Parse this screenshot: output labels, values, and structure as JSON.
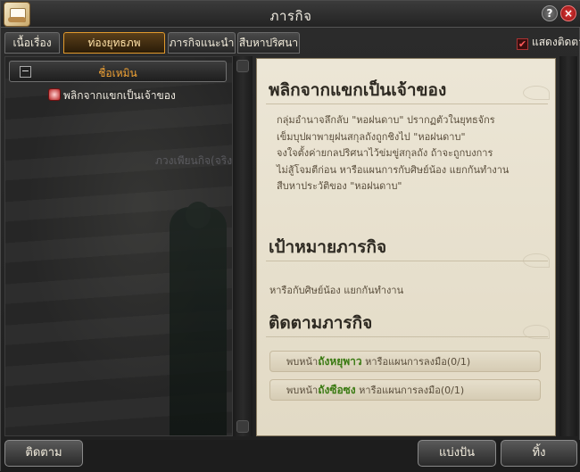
{
  "window": {
    "title": "ภารกิจ"
  },
  "tabs": [
    {
      "label": "เนื้อเรื่อง"
    },
    {
      "label": "ท่องยุทธภพ"
    },
    {
      "label": "ภารกิจแนะนำ"
    },
    {
      "label": "สืบหาปริศนา"
    }
  ],
  "show_tracking": {
    "label": "แสดงติดตาม",
    "checked": true
  },
  "quest_list": {
    "category": "ชื่อเหมิน",
    "items": [
      {
        "label": "พลิกจากแขกเป็นเจ้าของ",
        "icon": "quest-scroll-icon"
      }
    ],
    "background_text": "ภวงเพียนกิจ(จริงม"
  },
  "detail": {
    "title": "พลิกจากแขกเป็นเจ้าของ",
    "description_lines": [
      "กลุ่มอำนาจลึกลับ \"หอฝนดาบ\" ปรากฏตัวในยุทธจักร",
      "เข็มบุปผาพายุฝนสกุลถังถูกชิงไป \"หอฝนดาบ\"",
      "จงใจตั้งค่ายกลปริศนาไว้ข่มขู่สกุลถัง ถ้าจะถูกบงการ",
      "ไม่สู้โจมตีก่อน หารือแผนการกับศิษย์น้อง แยกกันทำงาน",
      "สืบหาประวัติของ \"หอฝนดาบ\""
    ],
    "goal_heading": "เป้าหมายภารกิจ",
    "goal_text": "หารือกับศิษย์น้อง แยกกันทำงาน",
    "tracking_heading": "ติดตามภารกิจ",
    "tracking": [
      {
        "prefix": "พบหน้า",
        "name": "ถังหยุพาว",
        "suffix": " หารือแผนการลงมือ(0/1)"
      },
      {
        "prefix": "พบหน้า",
        "name": "ถังซือซง",
        "suffix": " หารือแผนการลงมือ(0/1)"
      }
    ]
  },
  "footer": {
    "track_label": "ติดตาม",
    "share_label": "แบ่งปัน",
    "abandon_label": "ทิ้ง"
  },
  "colors": {
    "accent": "#e29a2c",
    "highlight_name": "#3a7a12",
    "close": "#c81818"
  }
}
